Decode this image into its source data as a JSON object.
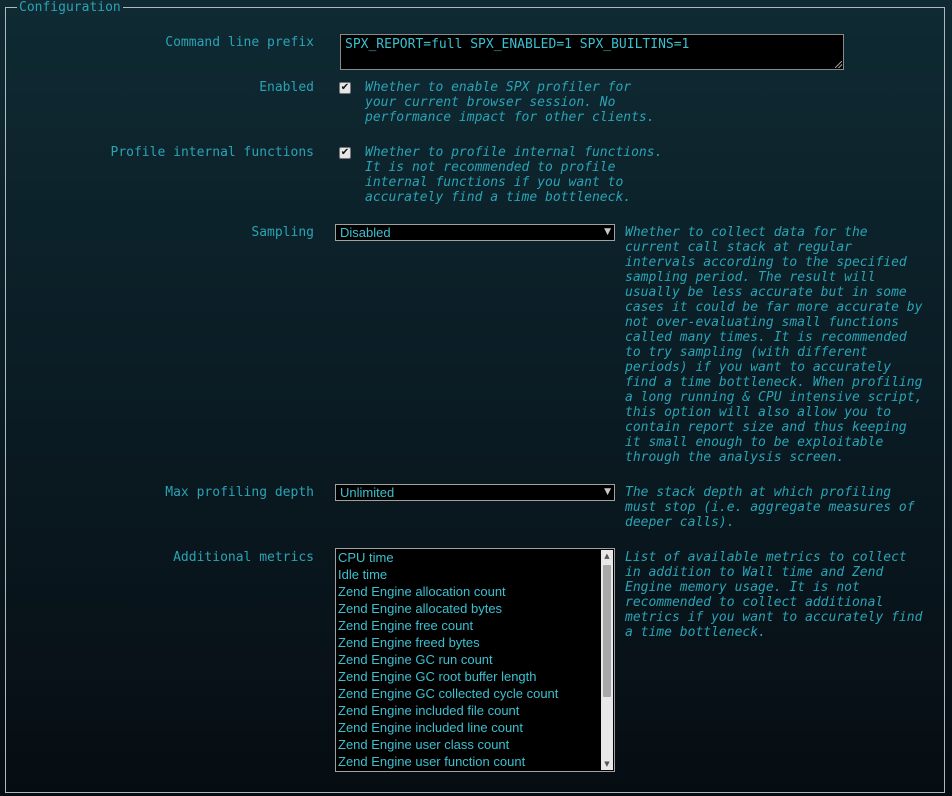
{
  "section": {
    "legend": "Configuration"
  },
  "command_line_prefix": {
    "label": "Command line prefix",
    "value": "SPX_REPORT=full SPX_ENABLED=1 SPX_BUILTINS=1"
  },
  "enabled": {
    "label": "Enabled",
    "checked": true,
    "check_glyph": "✔",
    "description": "Whether to enable SPX profiler for\nyour current browser session. No\nperformance impact for other clients."
  },
  "profile_internal": {
    "label": "Profile internal functions",
    "checked": true,
    "check_glyph": "✔",
    "description": "Whether to profile internal functions.\nIt is not recommended to profile\ninternal functions if you want to\naccurately find a time bottleneck."
  },
  "sampling": {
    "label": "Sampling",
    "selected": "Disabled",
    "arrow": "▼",
    "description": "Whether to collect data for the\ncurrent call stack at regular\nintervals according to the specified\nsampling period. The result will\nusually be less accurate but in some\ncases it could be far more accurate by\nnot over-evaluating small functions\ncalled many times. It is recommended\nto try sampling (with different\nperiods) if you want to accurately\nfind a time bottleneck. When profiling\na long running & CPU intensive script,\nthis option will also allow you to\ncontain report size and thus keeping\nit small enough to be exploitable\nthrough the analysis screen."
  },
  "max_depth": {
    "label": "Max profiling depth",
    "selected": "Unlimited",
    "arrow": "▼",
    "description": "The stack depth at which profiling\nmust stop (i.e. aggregate measures of\ndeeper calls)."
  },
  "additional_metrics": {
    "label": "Additional metrics",
    "options": [
      "CPU time",
      "Idle time",
      "Zend Engine allocation count",
      "Zend Engine allocated bytes",
      "Zend Engine free count",
      "Zend Engine freed bytes",
      "Zend Engine GC run count",
      "Zend Engine GC root buffer length",
      "Zend Engine GC collected cycle count",
      "Zend Engine included file count",
      "Zend Engine included line count",
      "Zend Engine user class count",
      "Zend Engine user function count"
    ],
    "scroll_up": "▲",
    "scroll_down": "▼",
    "description": "List of available metrics to collect\nin addition to Wall time and Zend\nEngine memory usage. It is not\nrecommended to collect additional\nmetrics if you want to accurately find\na time bottleneck."
  },
  "colors": {
    "text": "#2aa3b5",
    "input_text": "#3cc0d0",
    "input_bg": "#000000",
    "border": "#b0b8bc"
  }
}
